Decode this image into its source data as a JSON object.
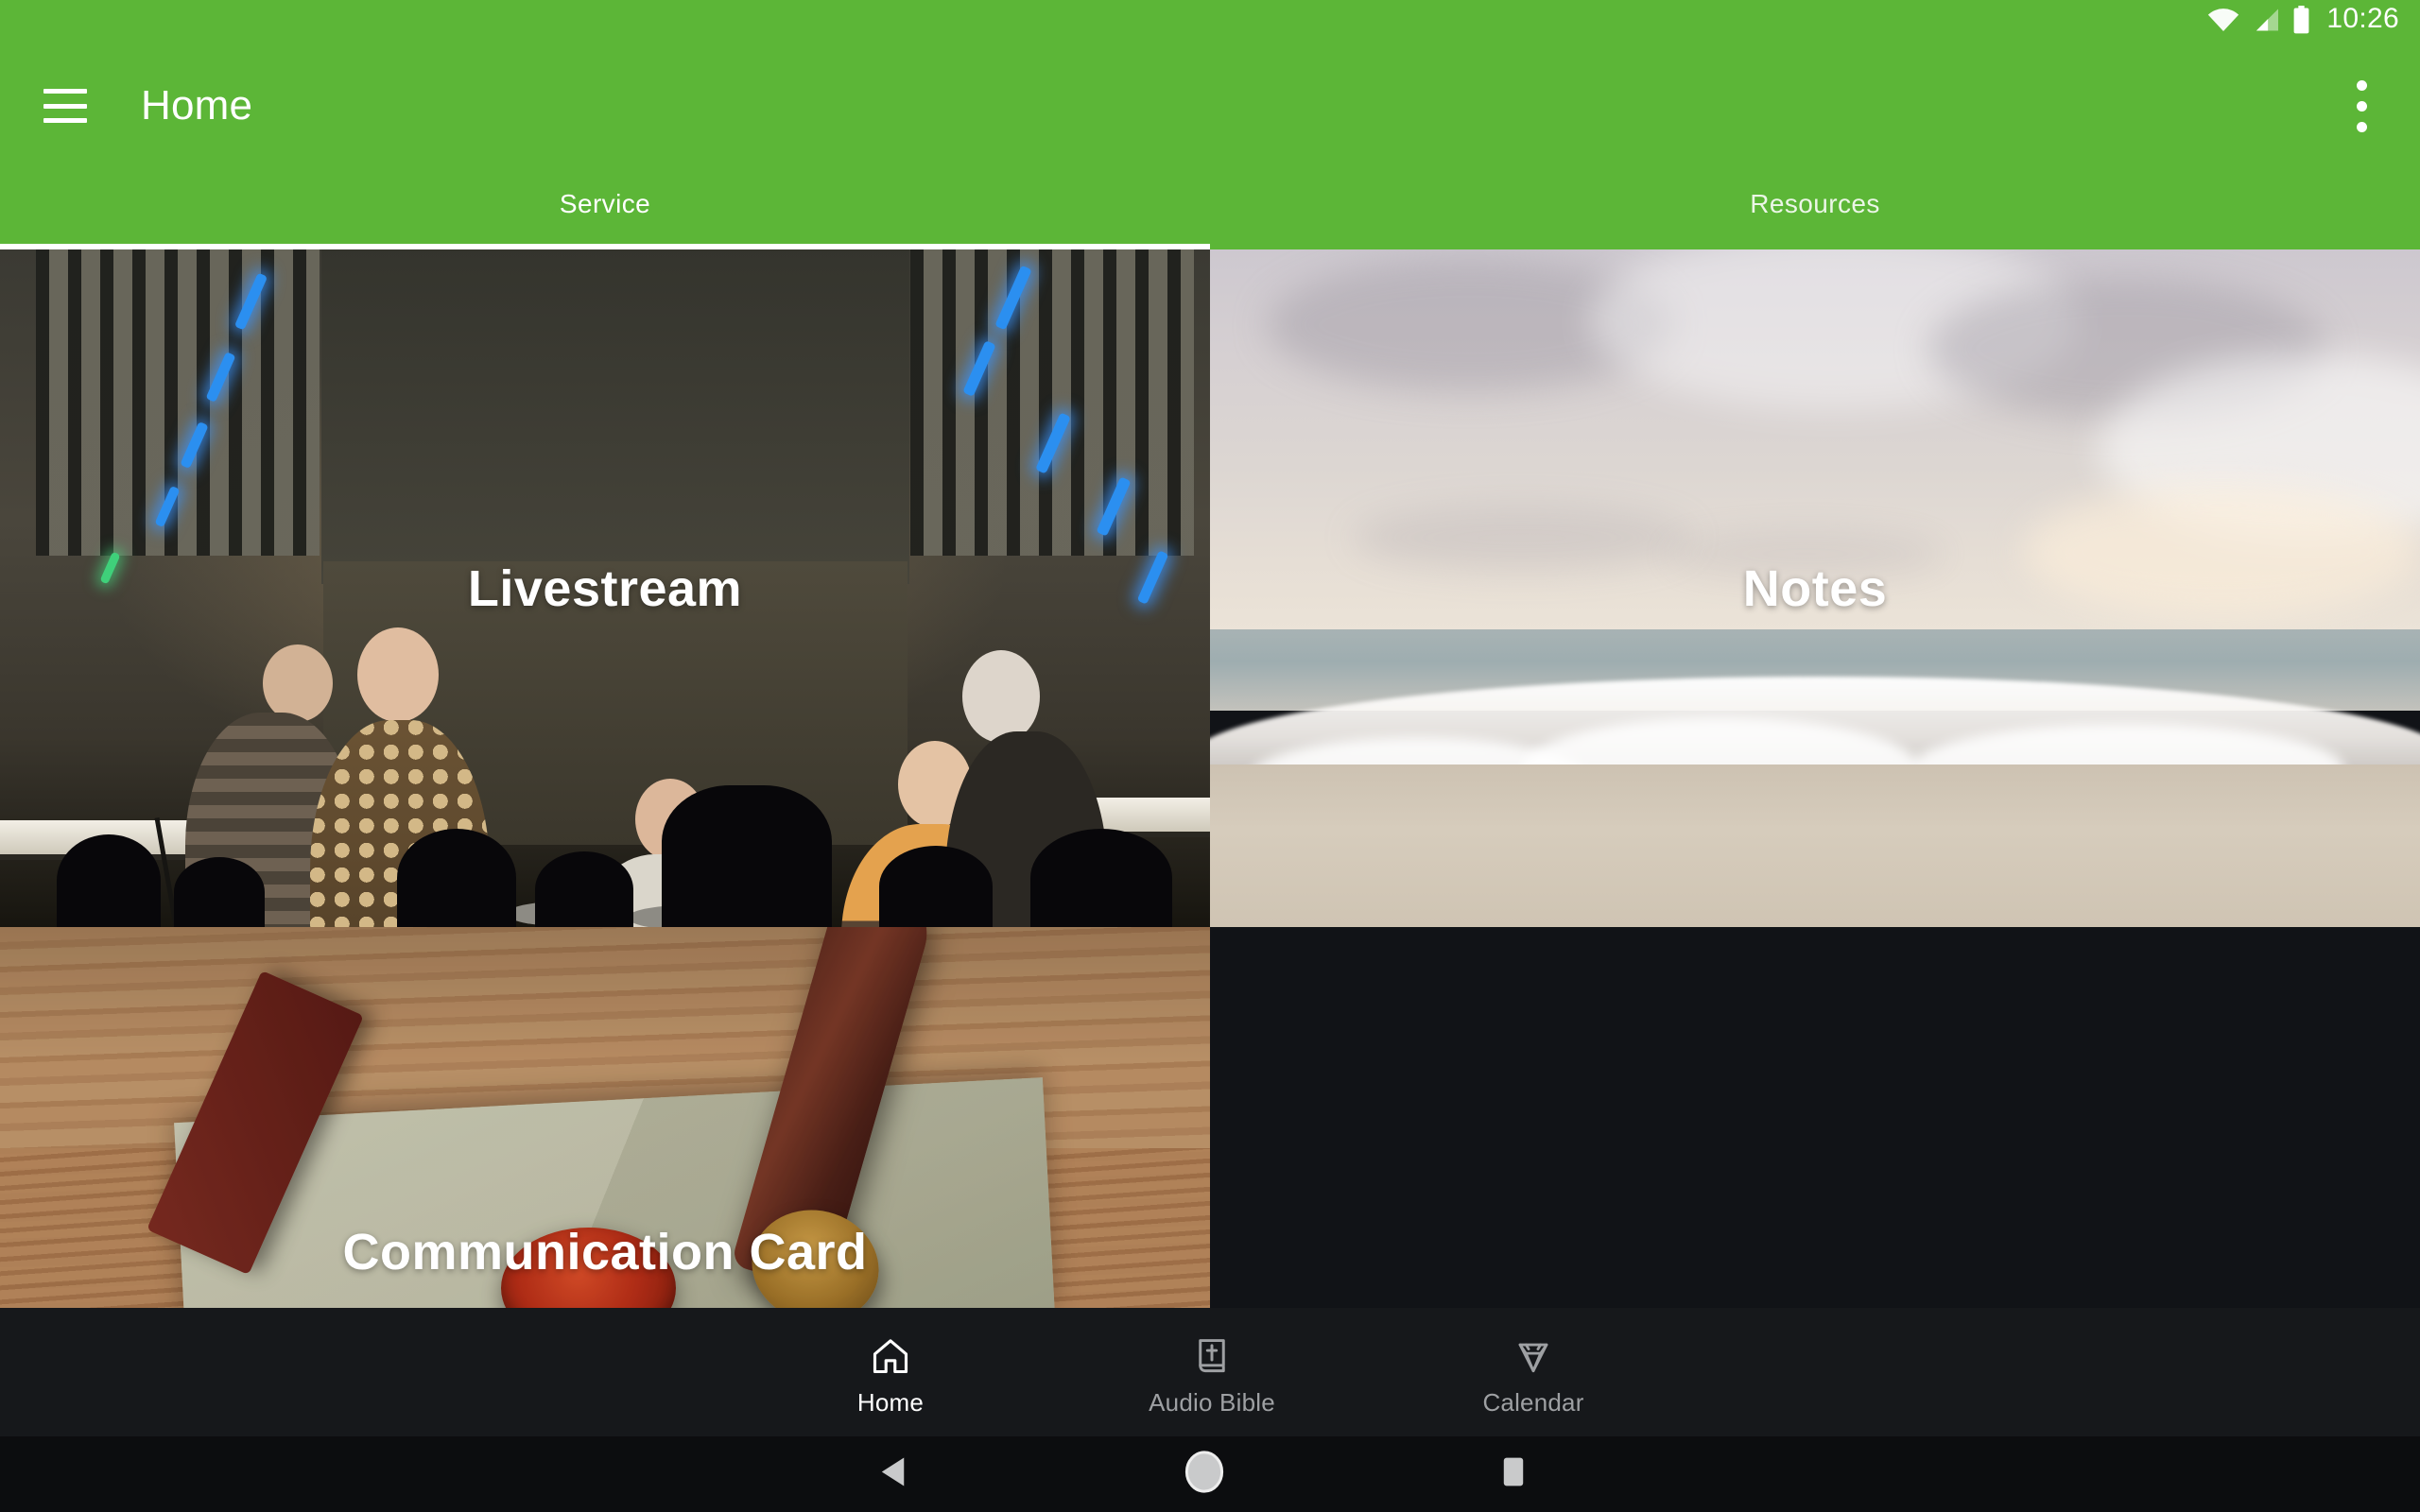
{
  "status_bar": {
    "time": "10:26",
    "icons": [
      "wifi-icon",
      "cellular-signal-icon",
      "battery-icon"
    ]
  },
  "app_bar": {
    "menu_icon": "hamburger-menu-icon",
    "title": "Home",
    "overflow_icon": "more-vertical-icon",
    "background_color": "#5CB637"
  },
  "tabs": {
    "active_index": 0,
    "items": [
      {
        "label": "Service",
        "active": true
      },
      {
        "label": "Resources",
        "active": false
      }
    ]
  },
  "cards": [
    {
      "label": "Livestream",
      "art": "worship-band-stage-photo"
    },
    {
      "label": "Notes",
      "art": "beach-wave-runners-photo"
    },
    {
      "label": "Communication Card",
      "art": "wax-seal-envelope-photo"
    }
  ],
  "bottom_nav": {
    "items": [
      {
        "label": "Home",
        "icon": "home-icon",
        "active": true
      },
      {
        "label": "Audio Bible",
        "icon": "bible-icon",
        "active": false
      },
      {
        "label": "Calendar",
        "icon": "diamond-icon",
        "active": false
      }
    ],
    "active_color": "#FFFFFF",
    "inactive_color": "#9EA0A3",
    "background_color": "#16181B"
  },
  "system_nav": {
    "buttons": [
      {
        "name": "back",
        "icon": "triangle-back-icon"
      },
      {
        "name": "home",
        "icon": "circle-home-icon"
      },
      {
        "name": "recents",
        "icon": "square-recents-icon"
      }
    ]
  }
}
